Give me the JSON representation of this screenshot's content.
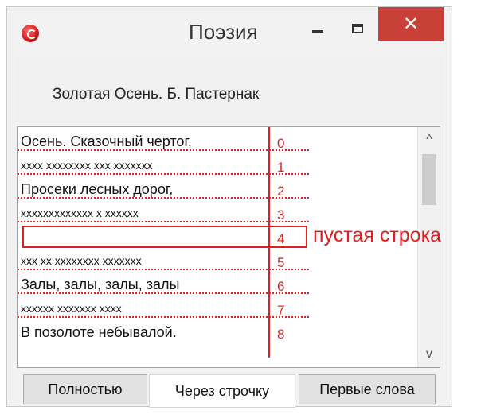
{
  "window": {
    "title": "Поэзия",
    "controls": {
      "minimize": "minimize",
      "maximize": "maximize",
      "close": "✕"
    }
  },
  "header": {
    "poem_title": "Золотая Осень. Б. Пастернак"
  },
  "poem": {
    "lines": [
      "Осень. Сказочный чертог,",
      "хххх хххххххх ххх ххххххх",
      "Просеки лесных дорог,",
      "ххххххххххххх х хххххх",
      "",
      "ххх хх хххххххх ххххххх",
      "Залы, залы, залы, залы",
      "хххххх ххххххх хххх",
      "В позолоте небывалой."
    ]
  },
  "annotations": {
    "line_numbers": [
      "0",
      "1",
      "2",
      "3",
      "4",
      "5",
      "6",
      "7",
      "8"
    ],
    "empty_line_label": "пустая строка",
    "color": "#e02020"
  },
  "buttons": {
    "full": "Полностью",
    "every_other": "Через строчку",
    "first_words": "Первые слова"
  },
  "scrollbar": {
    "up": "^",
    "down": "v"
  }
}
